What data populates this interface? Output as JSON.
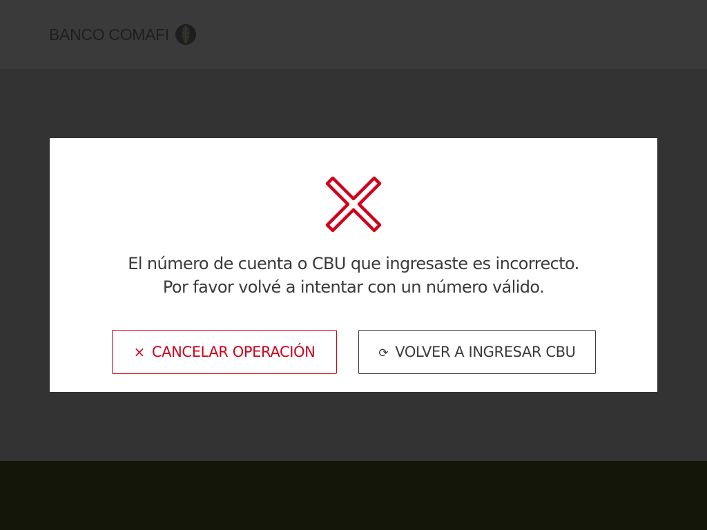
{
  "header": {
    "logo_text": "BANCO COMAFI",
    "logo_icon": "comafi-leaf-icon"
  },
  "modal": {
    "icon": "error-x-icon",
    "icon_color": "#d0021b",
    "message_line1": "El número de cuenta o CBU que ingresaste es incorrecto.",
    "message_line2": "Por favor volvé a intentar con un número válido.",
    "cancel_button": {
      "icon": "close-icon",
      "icon_glyph": "×",
      "label": "CANCELAR OPERACIÓN",
      "color": "#d0021b"
    },
    "retry_button": {
      "icon": "refresh-icon",
      "icon_glyph": "⟳",
      "label": "VOLVER A INGRESAR CBU",
      "color": "#3a3a3a"
    }
  },
  "colors": {
    "backdrop": "#333333",
    "header": "#3a3a3a",
    "footer": "#14160a",
    "modal_bg": "#ffffff"
  }
}
